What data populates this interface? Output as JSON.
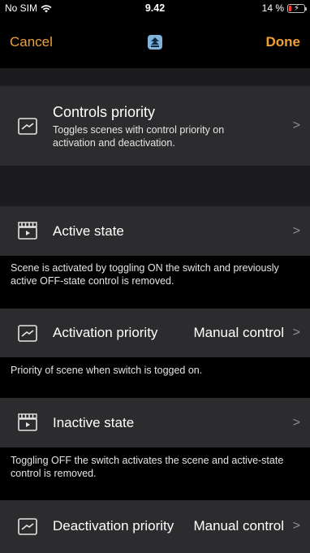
{
  "status_bar": {
    "carrier": "No SIM",
    "time": "9.42",
    "battery_percent": "14 %",
    "battery_level": 0.14,
    "wifi_icon": "wifi-icon",
    "battery_icon": "battery-charging-icon"
  },
  "nav": {
    "cancel_label": "Cancel",
    "done_label": "Done",
    "center_icon": "scene-app-icon",
    "accent_color": "#f0a030"
  },
  "sections": {
    "controls_priority": {
      "title": "Controls priority",
      "subtitle": "Toggles scenes with control priority on activation and deactivation.",
      "icon": "priority-chart-icon"
    },
    "active_state": {
      "title": "Active state",
      "icon": "clapperboard-icon",
      "note": "Scene is activated by toggling ON the switch and previously active OFF-state control is removed."
    },
    "activation_priority": {
      "title": "Activation priority",
      "value": "Manual control",
      "icon": "priority-chart-icon",
      "note": "Priority of scene when switch is togged on."
    },
    "inactive_state": {
      "title": "Inactive state",
      "icon": "clapperboard-icon",
      "note": "Toggling OFF the switch activates the scene and active-state control is removed."
    },
    "deactivation_priority": {
      "title": "Deactivation priority",
      "value": "Manual control",
      "icon": "priority-chart-icon"
    }
  },
  "chevron_glyph": ">"
}
